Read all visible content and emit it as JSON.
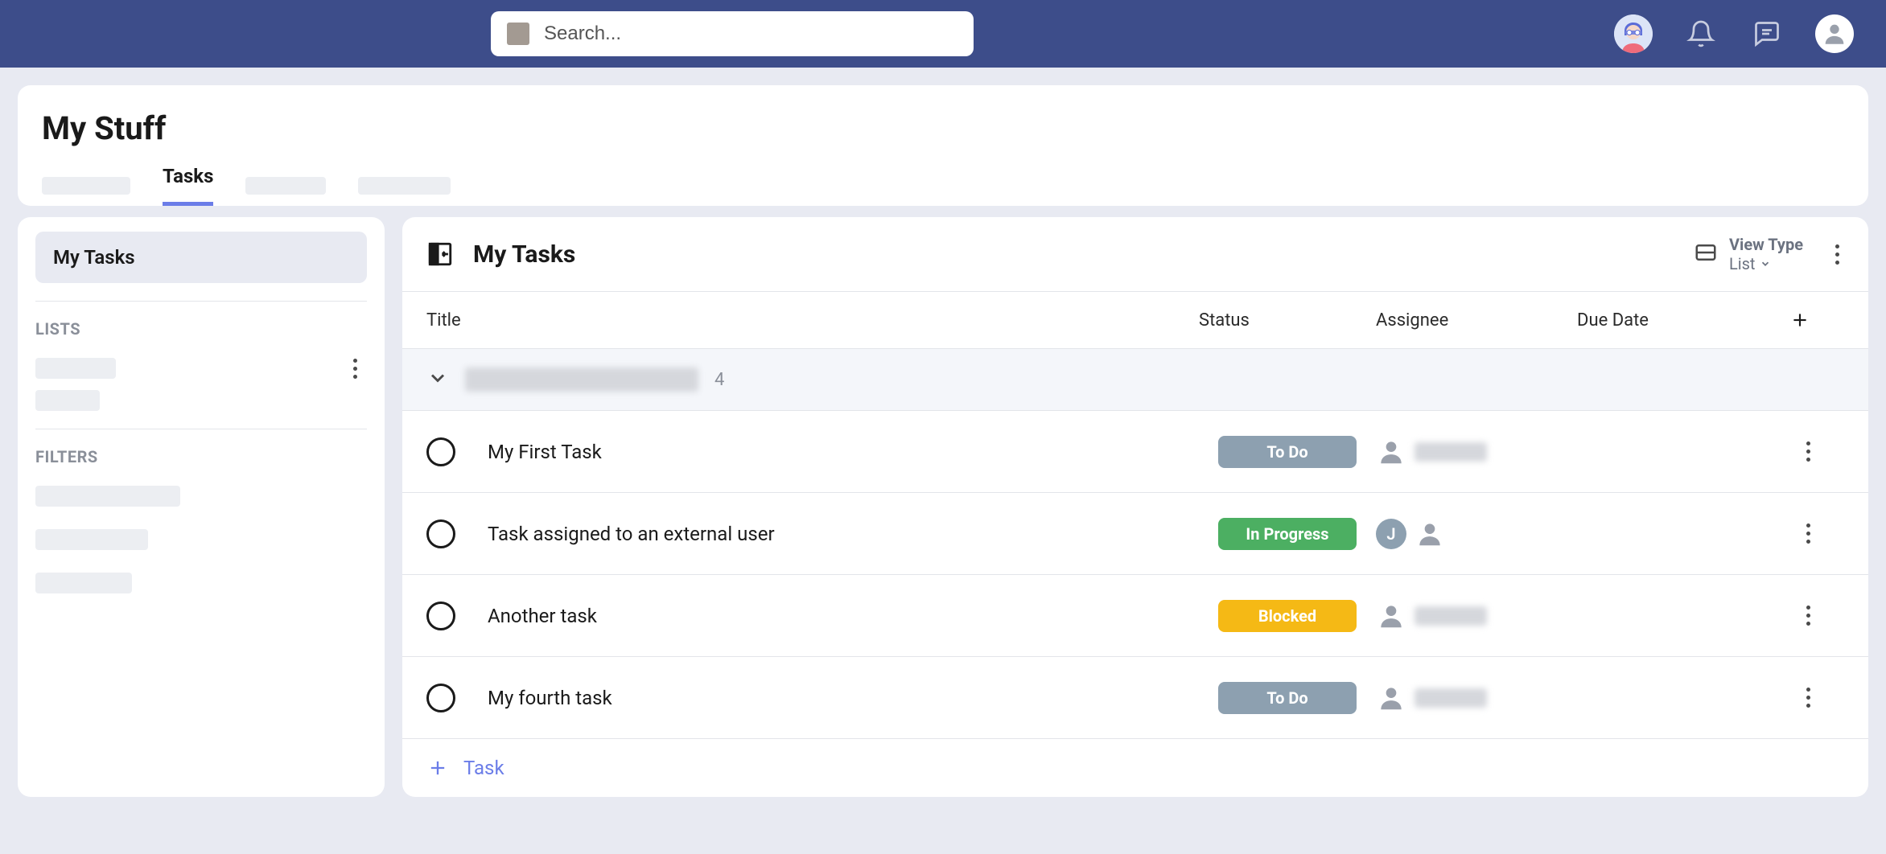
{
  "header": {
    "search_placeholder": "Search..."
  },
  "page": {
    "title": "My Stuff",
    "active_tab": "Tasks"
  },
  "sidebar": {
    "active_item": "My Tasks",
    "lists_heading": "LISTS",
    "filters_heading": "FILTERS"
  },
  "content": {
    "title": "My Tasks",
    "view_type_label": "View Type",
    "view_type_value": "List",
    "columns": {
      "title": "Title",
      "status": "Status",
      "assignee": "Assignee",
      "due": "Due Date"
    },
    "group": {
      "count": "4"
    },
    "tasks": [
      {
        "title": "My First Task",
        "status": "To Do",
        "status_class": "status-todo",
        "assignee_initial": ""
      },
      {
        "title": "Task assigned to an external user",
        "status": "In Progress",
        "status_class": "status-progress",
        "assignee_initial": "J"
      },
      {
        "title": "Another task",
        "status": "Blocked",
        "status_class": "status-blocked",
        "assignee_initial": ""
      },
      {
        "title": "My fourth task",
        "status": "To Do",
        "status_class": "status-todo",
        "assignee_initial": ""
      }
    ],
    "add_task_label": "Task"
  }
}
